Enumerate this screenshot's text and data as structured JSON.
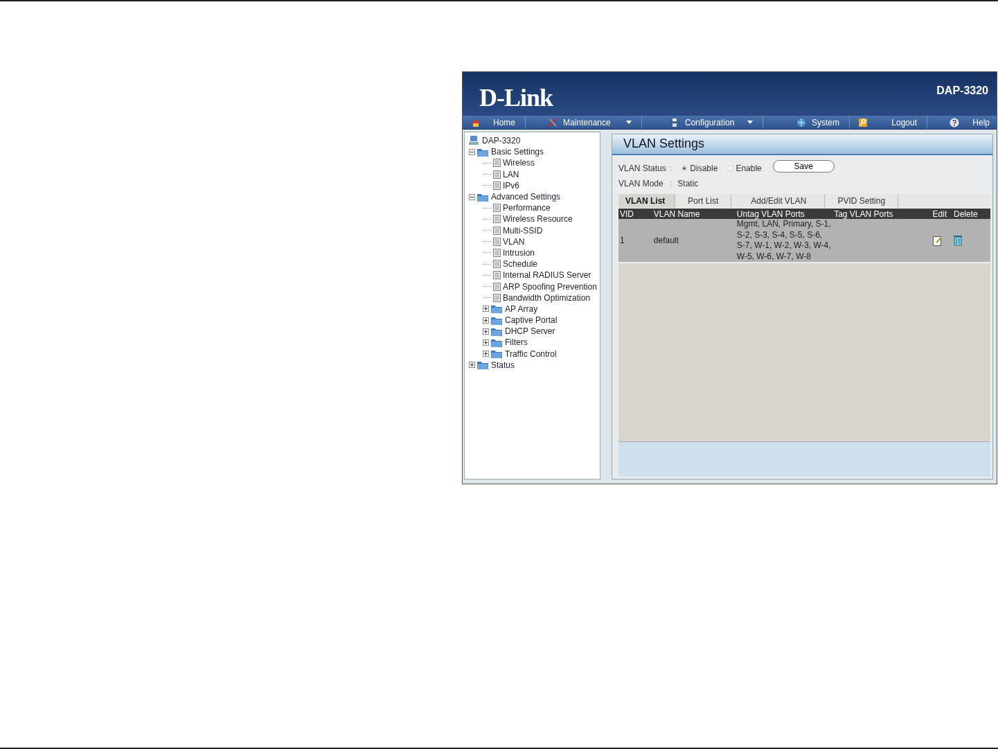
{
  "header": {
    "logo": "D-Link",
    "model": "DAP-3320"
  },
  "nav": [
    {
      "label": "Home",
      "kind": "home",
      "has_menu": false
    },
    {
      "label": "Maintenance",
      "kind": "tools",
      "has_menu": true
    },
    {
      "label": "Configuration",
      "kind": "disk",
      "has_menu": true
    },
    {
      "label": "System",
      "kind": "globe",
      "has_menu": false
    },
    {
      "label": "Logout",
      "kind": "key",
      "has_menu": false
    },
    {
      "label": "Help",
      "kind": "help",
      "has_menu": false
    }
  ],
  "tree": [
    {
      "label": "DAP-3320",
      "kind": "device",
      "children": [
        {
          "label": "Basic Settings",
          "kind": "folder",
          "expanded": true,
          "children": [
            {
              "label": "Wireless",
              "kind": "page"
            },
            {
              "label": "LAN",
              "kind": "page"
            },
            {
              "label": "IPv6",
              "kind": "page"
            }
          ]
        },
        {
          "label": "Advanced Settings",
          "kind": "folder",
          "expanded": true,
          "children": [
            {
              "label": "Performance",
              "kind": "page"
            },
            {
              "label": "Wireless Resource",
              "kind": "page"
            },
            {
              "label": "Multi-SSID",
              "kind": "page"
            },
            {
              "label": "VLAN",
              "kind": "page"
            },
            {
              "label": "Intrusion",
              "kind": "page"
            },
            {
              "label": "Schedule",
              "kind": "page"
            },
            {
              "label": "Internal RADIUS Server",
              "kind": "page"
            },
            {
              "label": "ARP Spoofing Prevention",
              "kind": "page"
            },
            {
              "label": "Bandwidth Optimization",
              "kind": "page"
            },
            {
              "label": "AP Array",
              "kind": "folder",
              "expanded": false
            },
            {
              "label": "Captive Portal",
              "kind": "folder",
              "expanded": false
            },
            {
              "label": "DHCP Server",
              "kind": "folder",
              "expanded": false
            },
            {
              "label": "Filters",
              "kind": "folder",
              "expanded": false
            },
            {
              "label": "Traffic Control",
              "kind": "folder",
              "expanded": false
            }
          ]
        },
        {
          "label": "Status",
          "kind": "folder",
          "expanded": false
        }
      ]
    }
  ],
  "panel": {
    "title": "VLAN Settings",
    "status": {
      "label": "VLAN Status",
      "separator": ":",
      "options": [
        {
          "label": "Disable",
          "selected": true
        },
        {
          "label": "Enable",
          "selected": false
        }
      ],
      "save": "Save"
    },
    "mode": {
      "label": "VLAN Mode",
      "separator": ":",
      "value": "Static"
    },
    "tabs": [
      {
        "label": "VLAN List",
        "selected": true
      },
      {
        "label": "Port List",
        "selected": false
      },
      {
        "label": "Add/Edit VLAN",
        "selected": false
      },
      {
        "label": "PVID Setting",
        "selected": false
      }
    ],
    "table": {
      "columns": [
        "VID",
        "VLAN Name",
        "Untag VLAN Ports",
        "Tag VLAN Ports",
        "Edit",
        "Delete"
      ],
      "rows": [
        {
          "vid": "1",
          "name": "default",
          "untag": "Mgmt, LAN, Primary, S-1, S-2, S-3, S-4, S-5, S-6, S-7, W-1, W-2, W-3, W-4, W-5, W-6, W-7, W-8"
        }
      ]
    }
  }
}
